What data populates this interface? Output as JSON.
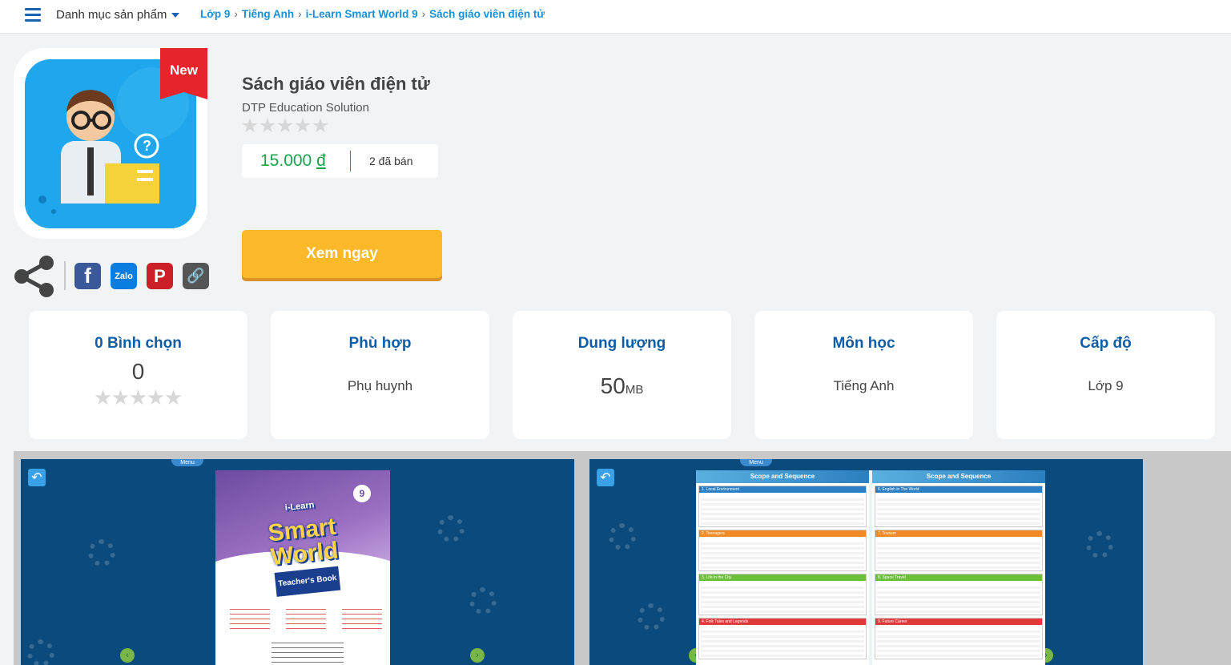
{
  "topbar": {
    "category_menu": "Danh mục sản phẩm",
    "breadcrumb": [
      "Lớp 9",
      "Tiếng Anh",
      "i-Learn Smart World 9",
      "Sách giáo viên điện tử"
    ]
  },
  "product": {
    "badge": "New",
    "title": "Sách giáo viên điện tử",
    "publisher": "DTP Education Solution",
    "rating_stars": 0,
    "price": "15.000",
    "currency": "đ",
    "sold": "2 đã bán",
    "view_button": "Xem ngay"
  },
  "share": {
    "icons": [
      "share-icon",
      "facebook-icon",
      "zalo-icon",
      "pinterest-icon",
      "link-icon"
    ],
    "zalo_label": "Zalo"
  },
  "stats": [
    {
      "label": "0 Bình chọn",
      "value": "0"
    },
    {
      "label": "Phù hợp",
      "value": "Phụ huynh"
    },
    {
      "label": "Dung lượng",
      "value": "50",
      "unit": "MB"
    },
    {
      "label": "Môn học",
      "value": "Tiếng Anh"
    },
    {
      "label": "Cấp độ",
      "value": "Lớp 9"
    }
  ],
  "preview": {
    "menu_label": "Menu",
    "cover": {
      "brand": "i-Learn",
      "title_line1": "Smart",
      "title_line2": "World",
      "subtitle": "Teacher's Book",
      "grade": "9"
    },
    "spread_heading": "Scope and Sequence",
    "units_left": [
      "1. Local Environment",
      "2. Teenagers",
      "3. Life in the City",
      "4. Folk Tales and Legends"
    ],
    "units_right": [
      "6. English in The World",
      "7. Tourism",
      "8. Space Travel",
      "9. Future Career"
    ]
  },
  "colors": {
    "accent_blue": "#0d5ea6",
    "link_blue": "#1a90d8",
    "price_green": "#1aa34a",
    "button_orange": "#fbb829",
    "badge_red": "#e5242b"
  }
}
